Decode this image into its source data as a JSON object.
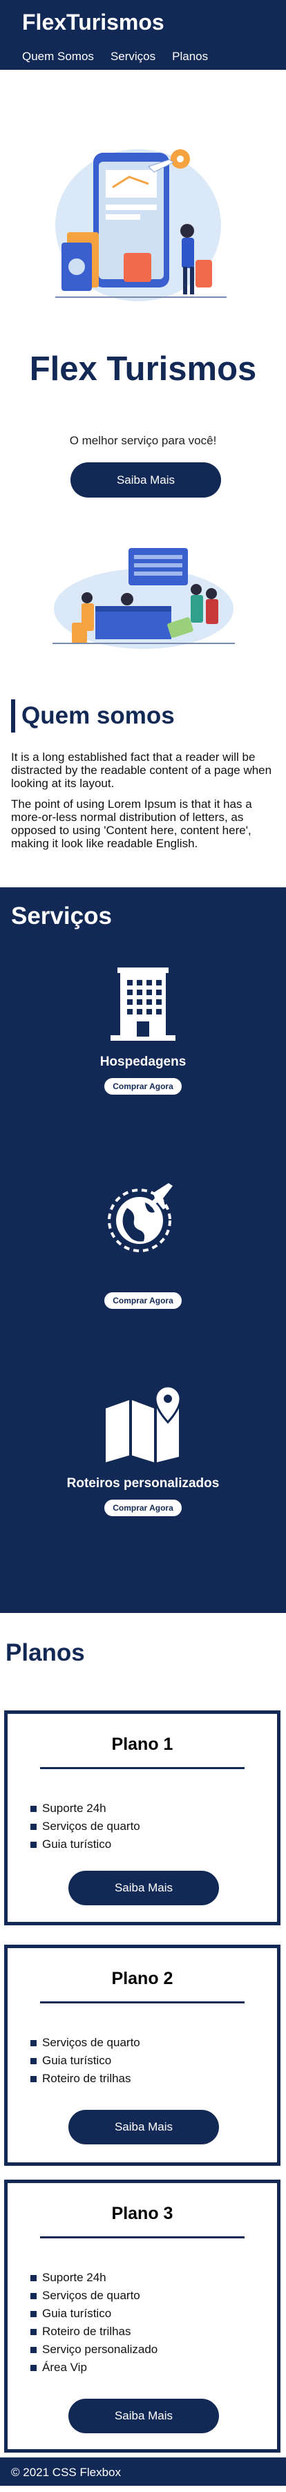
{
  "header": {
    "logo": "FlexTurismos",
    "nav": [
      {
        "label": "Quem Somos"
      },
      {
        "label": "Serviços"
      },
      {
        "label": "Planos"
      }
    ]
  },
  "hero": {
    "title": "Flex Turismos",
    "subtitle": "O melhor serviço para você!",
    "button_label": "Saiba Mais"
  },
  "about": {
    "title": "Quem somos",
    "paragraphs": [
      "It is a long established fact that a reader will be distracted by the readable content of a page when looking at its layout.",
      "The point of using Lorem Ipsum is that it has a more-or-less normal distribution of letters, as opposed to using 'Content here, content here', making it look like readable English."
    ]
  },
  "services": {
    "title": "Serviços",
    "items": [
      {
        "name": "Hospedagens",
        "icon": "building-icon",
        "button_label": "Comprar Agora"
      },
      {
        "name": "",
        "icon": "globe-airplane-icon",
        "button_label": "Comprar Agora"
      },
      {
        "name": "Roteiros personalizados",
        "icon": "map-pin-icon",
        "button_label": "Comprar Agora"
      }
    ]
  },
  "plans": {
    "title": "Planos",
    "items": [
      {
        "name": "Plano 1",
        "features": [
          "Suporte 24h",
          "Serviços de quarto",
          "Guia turístico"
        ],
        "button_label": "Saiba Mais"
      },
      {
        "name": "Plano 2",
        "features": [
          "Serviços de quarto",
          "Guia turístico",
          "Roteiro de trilhas"
        ],
        "button_label": "Saiba Mais"
      },
      {
        "name": "Plano 3",
        "features": [
          "Suporte 24h",
          "Serviços de quarto",
          "Guia turístico",
          "Roteiro de trilhas",
          "Serviço personalizado",
          "Área Vip"
        ],
        "button_label": "Saiba Mais"
      }
    ]
  },
  "footer": {
    "text": "© 2021 CSS Flexbox"
  },
  "colors": {
    "primary": "#132955",
    "accent_orange": "#f4a340",
    "accent_light_blue": "#dbe8f7",
    "white": "#ffffff"
  }
}
